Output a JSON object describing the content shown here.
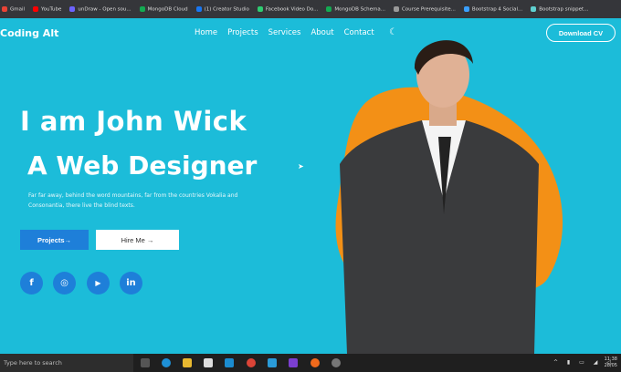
{
  "bookmarks": [
    {
      "label": "Gmail",
      "color": "#ea4335"
    },
    {
      "label": "YouTube",
      "color": "#ff0000"
    },
    {
      "label": "unDraw - Open sou...",
      "color": "#6c63ff"
    },
    {
      "label": "MongoDB Cloud",
      "color": "#13aa52"
    },
    {
      "label": "(1) Creator Studio",
      "color": "#1877f2"
    },
    {
      "label": "Facebook Video Do...",
      "color": "#2ecc71"
    },
    {
      "label": "MongoDB Schema...",
      "color": "#13aa52"
    },
    {
      "label": "Course Prerequisite...",
      "color": "#999999"
    },
    {
      "label": "Bootstrap 4 Social...",
      "color": "#3aa0ff"
    },
    {
      "label": "Bootstrap snippet...",
      "color": "#5fd0d0"
    }
  ],
  "site": {
    "logo": "Coding Alt",
    "nav": [
      "Home",
      "Projects",
      "Services",
      "About",
      "Contact"
    ],
    "theme_icon": "moon-icon",
    "download": "Download CV"
  },
  "hero": {
    "line1": "I am John Wick",
    "line2": "A Web Designer",
    "paragraph": "Far far away, behind the word mountains, far from the countries Vokalia and Consonantia, there live the blind texts.",
    "projects_btn": "Projects→",
    "hire_btn": "Hire Me →",
    "social": [
      {
        "name": "facebook-icon",
        "glyph": "f"
      },
      {
        "name": "instagram-icon",
        "glyph": "◎"
      },
      {
        "name": "youtube-icon",
        "glyph": "▶"
      },
      {
        "name": "linkedin-icon",
        "glyph": "in"
      }
    ]
  },
  "colors": {
    "bg": "#1cbcd9",
    "accent": "#1e7fd9",
    "blob": "#f39016"
  },
  "taskbar": {
    "search": "Type here to search",
    "time": "11:38",
    "date": "28/05"
  }
}
